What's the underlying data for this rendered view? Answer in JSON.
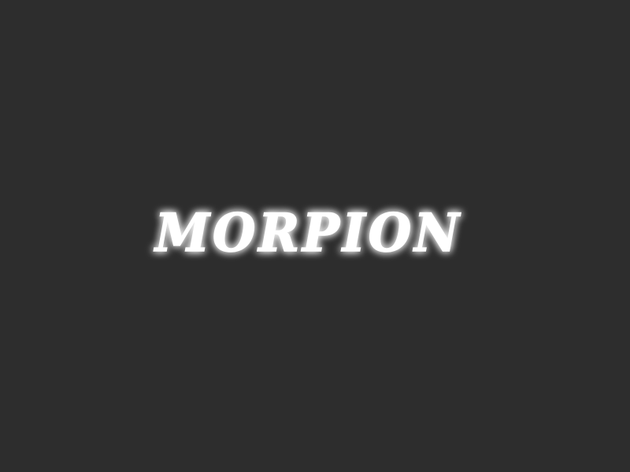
{
  "game": {
    "title": "MORPION"
  },
  "colors": {
    "background": "#2d2d2d",
    "title": "#ffffff",
    "glow": "#ffffff"
  }
}
